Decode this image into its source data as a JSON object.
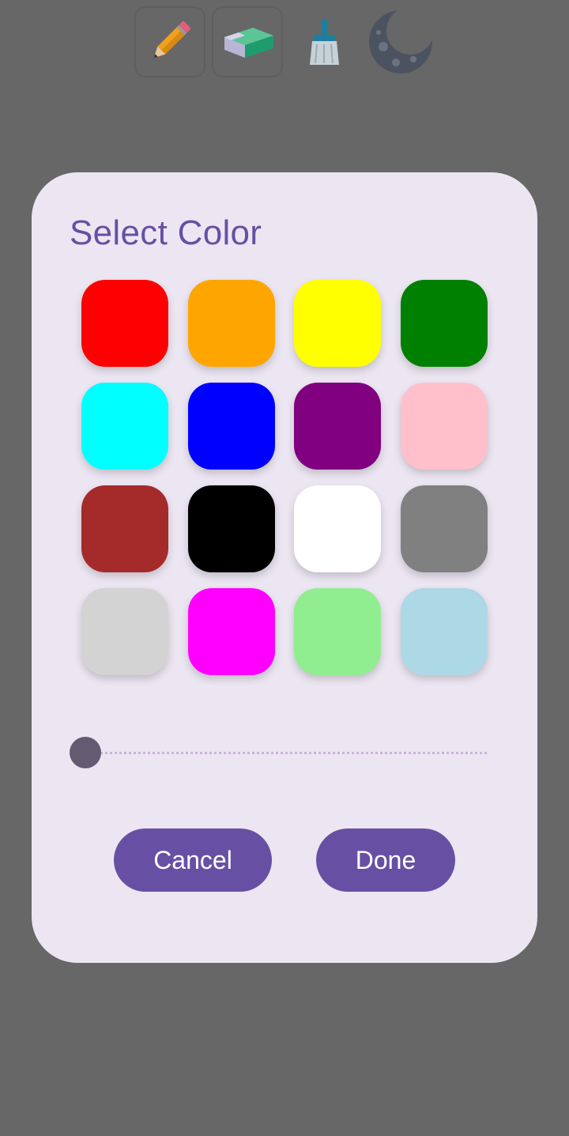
{
  "toolbar": {
    "tools": [
      {
        "name": "pencil-icon",
        "selected": true
      },
      {
        "name": "eraser-icon",
        "selected": true
      },
      {
        "name": "broom-icon",
        "selected": false
      },
      {
        "name": "moon-icon",
        "selected": false
      }
    ]
  },
  "dialog": {
    "title": "Select Color",
    "swatches": [
      {
        "color": "#ff0000"
      },
      {
        "color": "#ffa500"
      },
      {
        "color": "#ffff00"
      },
      {
        "color": "#008000"
      },
      {
        "color": "#00ffff"
      },
      {
        "color": "#0000ff"
      },
      {
        "color": "#800080"
      },
      {
        "color": "#ffc0cb"
      },
      {
        "color": "#a52a2a"
      },
      {
        "color": "#000000"
      },
      {
        "color": "#ffffff"
      },
      {
        "color": "#808080"
      },
      {
        "color": "#d3d3d3"
      },
      {
        "color": "#ff00ff"
      },
      {
        "color": "#90ee90"
      },
      {
        "color": "#add8e6"
      }
    ],
    "slider": {
      "value": 0.0
    },
    "cancel_label": "Cancel",
    "done_label": "Done"
  },
  "colors": {
    "background": "#676767",
    "dialog_bg": "#ece6f2",
    "accent": "#6750a4",
    "thumb": "#625b71"
  }
}
